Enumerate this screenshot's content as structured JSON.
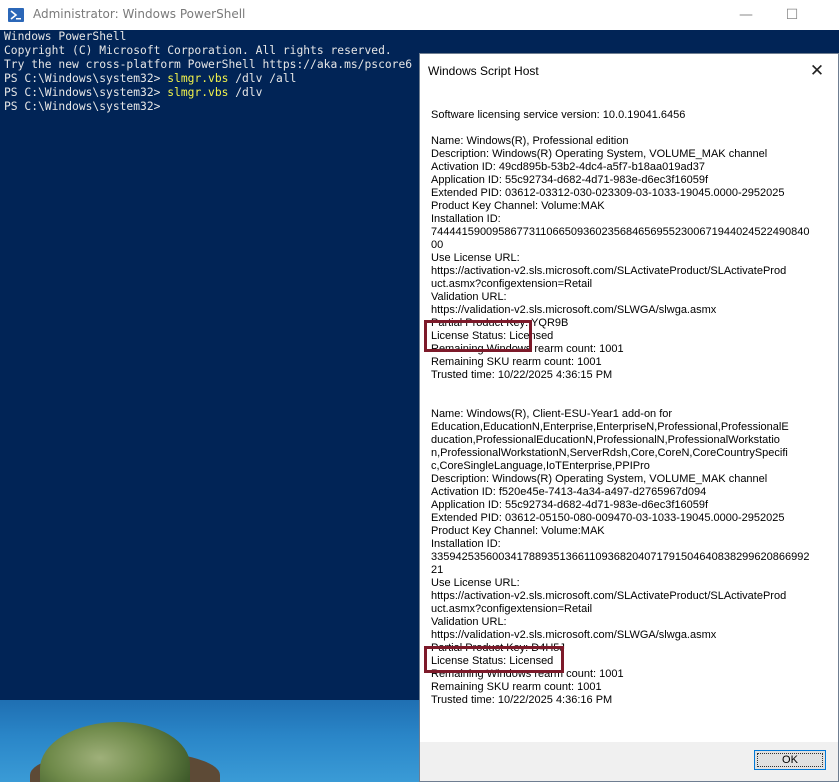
{
  "powershell": {
    "title": "Administrator: Windows PowerShell",
    "controls": {
      "minimize": "—",
      "maximize": "☐",
      "close": "✕"
    },
    "lines": [
      {
        "text": "Windows PowerShell"
      },
      {
        "text": "Copyright (C) Microsoft Corporation. All rights reserved."
      },
      {
        "text": ""
      },
      {
        "text": "Try the new cross-platform PowerShell https://aka.ms/pscore6"
      },
      {
        "text": ""
      },
      {
        "prompt": "PS C:\\Windows\\system32> ",
        "cmd": "slmgr.vbs",
        "args": " /dlv /all"
      },
      {
        "prompt": "PS C:\\Windows\\system32> ",
        "cmd": "slmgr.vbs",
        "args": " /dlv"
      },
      {
        "prompt": "PS C:\\Windows\\system32> ",
        "cmd": "",
        "args": ""
      }
    ]
  },
  "dialog": {
    "title": "Windows Script Host",
    "close": "✕",
    "lines": [
      "Software licensing service version: 10.0.19041.6456",
      "",
      "Name: Windows(R), Professional edition",
      "Description: Windows(R) Operating System, VOLUME_MAK channel",
      "Activation ID: 49cd895b-53b2-4dc4-a5f7-b18aa019ad37",
      "Application ID: 55c92734-d682-4d71-983e-d6ec3f16059f",
      "Extended PID: 03612-03312-030-023309-03-1033-19045.0000-2952025",
      "Product Key Channel: Volume:MAK",
      "Installation ID:",
      "74444159009586773110665093602356846569552300671944024522490840",
      "00",
      "Use License URL:",
      "https://activation-v2.sls.microsoft.com/SLActivateProduct/SLActivateProd",
      "uct.asmx?configextension=Retail",
      "Validation URL:",
      "https://validation-v2.sls.microsoft.com/SLWGA/slwga.asmx",
      "Partial Product Key: YQR9B",
      "License Status: Licensed",
      "Remaining Windows rearm count: 1001",
      "Remaining SKU rearm count: 1001",
      "Trusted time: 10/22/2025 4:36:15 PM",
      "",
      "",
      "Name: Windows(R), Client-ESU-Year1 add-on for",
      "Education,EducationN,Enterprise,EnterpriseN,Professional,ProfessionalE",
      "ducation,ProfessionalEducationN,ProfessionalN,ProfessionalWorkstatio",
      "n,ProfessionalWorkstationN,ServerRdsh,Core,CoreN,CoreCountrySpecifi",
      "c,CoreSingleLanguage,IoTEnterprise,PPIPro",
      "Description: Windows(R) Operating System, VOLUME_MAK channel",
      "Activation ID: f520e45e-7413-4a34-a497-d2765967d094",
      "Application ID: 55c92734-d682-4d71-983e-d6ec3f16059f",
      "Extended PID: 03612-05150-080-009470-03-1033-19045.0000-2952025",
      "Product Key Channel: Volume:MAK",
      "Installation ID:",
      "33594253560034178893513661109368204071791504640838299620866992",
      "21",
      "Use License URL:",
      "https://activation-v2.sls.microsoft.com/SLActivateProduct/SLActivateProd",
      "uct.asmx?configextension=Retail",
      "Validation URL:",
      "https://validation-v2.sls.microsoft.com/SLWGA/slwga.asmx",
      "Partial Product Key: D4H5J",
      "License Status: Licensed",
      "Remaining Windows rearm count: 1001",
      "Remaining SKU rearm count: 1001",
      "Trusted time: 10/22/2025 4:36:16 PM"
    ],
    "ok_label": "OK"
  },
  "highlight_color": "#7d1a2a",
  "console_bg": "#012456",
  "command_color": "#f2f24b"
}
